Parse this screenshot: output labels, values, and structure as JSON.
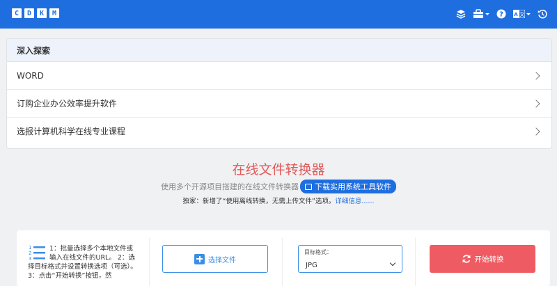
{
  "topbar": {
    "logo_letters": [
      "C",
      "D",
      "K",
      "M"
    ],
    "icons": [
      "layers-icon",
      "toolbox-icon",
      "help-icon",
      "language-icon",
      "history-icon"
    ]
  },
  "explore": {
    "title": "深入探索",
    "items": [
      {
        "label": "WORD"
      },
      {
        "label": "订购企业办公效率提升软件"
      },
      {
        "label": "选报计算机科学在线专业课程"
      }
    ]
  },
  "hero": {
    "title": "在线文件转换器",
    "subtitle": "使用多个开源项目搭建的在线文件转换器",
    "download_label": "下载实用系统工具软件",
    "note": "独家：新增了“使用离线转换，无需上传文件”选项。",
    "note_link": "详细信息......"
  },
  "panel": {
    "steps_text": "1：批量选择多个本地文件或输入在线文件的URL。 2：选择目标格式并设置转换选项（可选）。 3：点击“开始转换”按钮，然",
    "select_button": "选择文件",
    "format_label": "目标格式：",
    "format_value": "JPG",
    "start_button": "开始转换"
  },
  "colors": {
    "brand": "#1f6ee0",
    "accent_red": "#ef5b62",
    "title_red": "#e05a5a"
  }
}
